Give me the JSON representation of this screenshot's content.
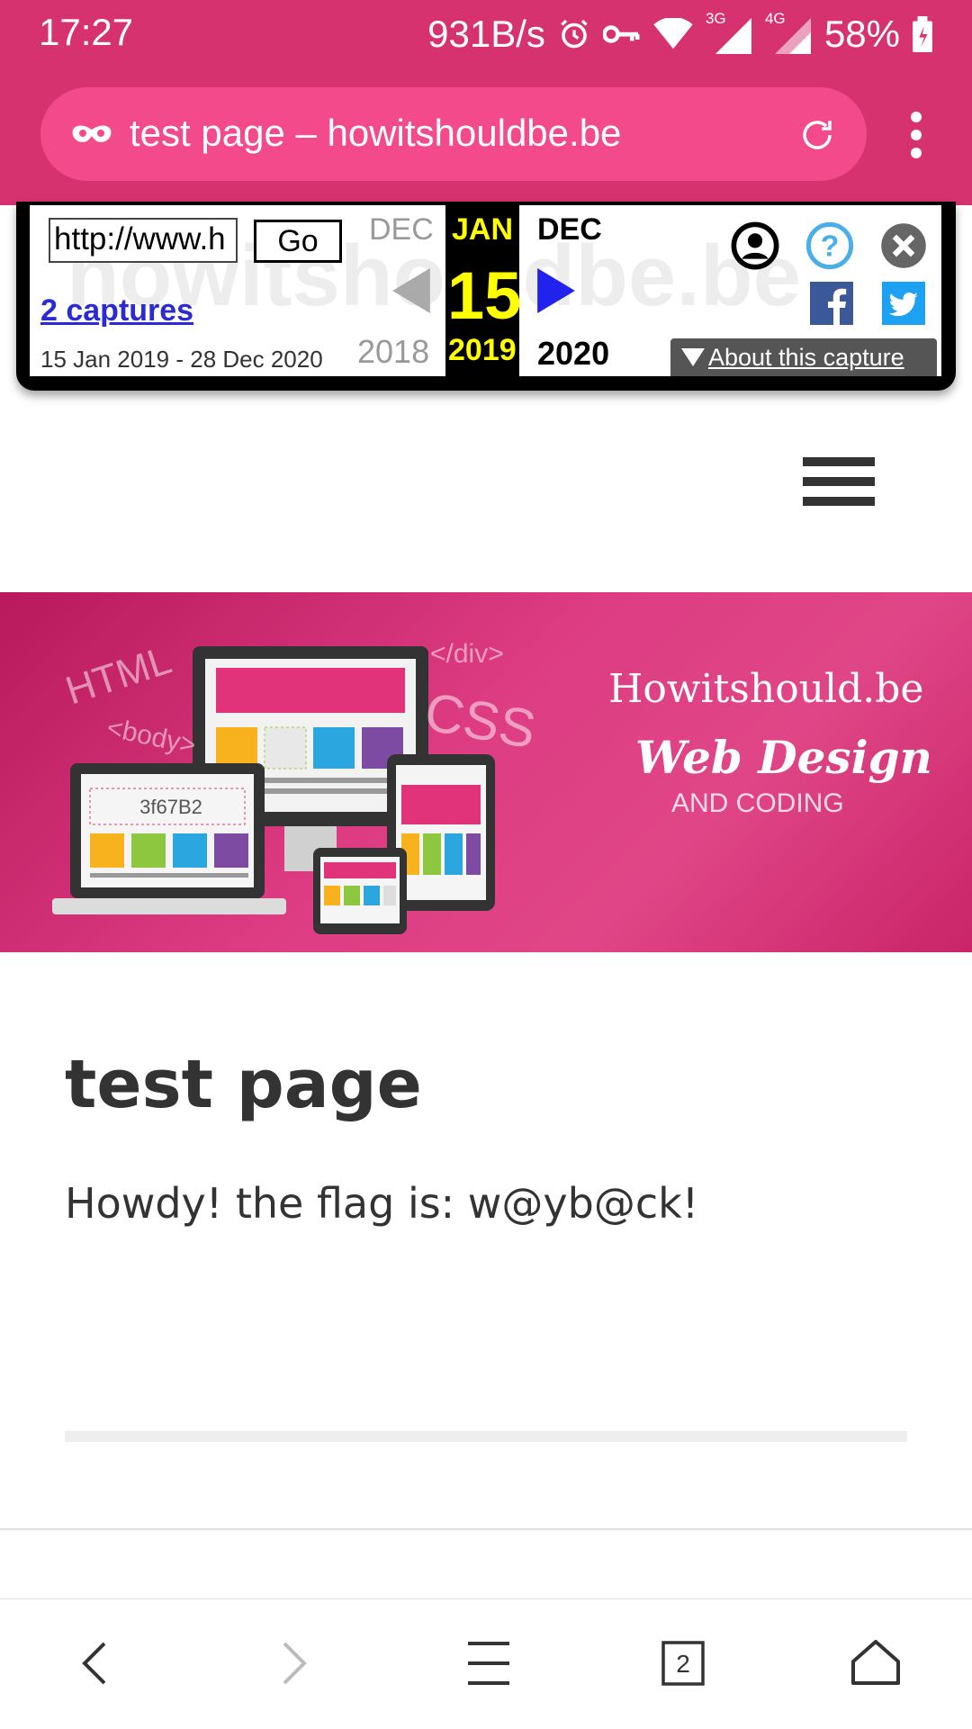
{
  "status_bar": {
    "time": "17:27",
    "network_speed": "931B/s",
    "signal_3g": "3G",
    "signal_4g": "4G",
    "battery": "58%",
    "icons": [
      "alarm-icon",
      "vpn-key-icon",
      "wifi-icon",
      "signal-icon",
      "battery-icon"
    ]
  },
  "browser": {
    "page_title_in_urlbar": "test page – howitshouldbe.be",
    "tab_count": "2",
    "icons": [
      "incognito-mask-icon",
      "reload-icon",
      "overflow-menu-icon"
    ]
  },
  "wayback": {
    "url_value": "http://www.h",
    "go_label": "Go",
    "captures_link": "2 captures",
    "date_range": "15 Jan 2019 - 28 Dec 2020",
    "prev_month": "DEC",
    "prev_year": "2018",
    "current_month": "JAN",
    "current_day": "15",
    "current_year": "2019",
    "next_month": "DEC",
    "next_year": "2020",
    "about_label": "About this capture",
    "watermark": "howitshouldbe.be"
  },
  "hero": {
    "brand": "Howitshould.be",
    "title": "Web Design",
    "subtitle": "AND CODING",
    "code_tags": [
      "HTML",
      "<body>",
      "</div>",
      "CSS"
    ],
    "device_label": "3f67B2"
  },
  "content": {
    "title": "test page",
    "body": "Howdy! the flag is: w@yb@ck!"
  },
  "colors": {
    "brand_pink": "#d6326f",
    "urlbar_pink": "#f34a8c",
    "wayback_yellow": "#ffff00",
    "link_blue": "#2a2ad6"
  }
}
